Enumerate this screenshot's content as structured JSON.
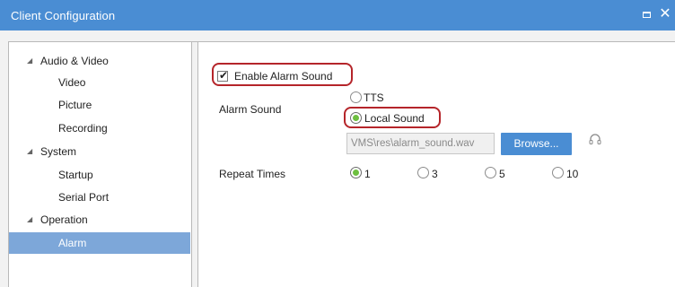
{
  "window": {
    "title": "Client Configuration",
    "maximize_icon": "maximize-icon",
    "close_icon": "close-icon",
    "close_glyph": "✕"
  },
  "tree": {
    "groups": [
      {
        "label": "Audio & Video",
        "caret": "◢",
        "children": [
          "Video",
          "Picture",
          "Recording"
        ]
      },
      {
        "label": "System",
        "caret": "◢",
        "children": [
          "Startup",
          "Serial Port"
        ]
      },
      {
        "label": "Operation",
        "caret": "◢",
        "children": [
          "Alarm"
        ]
      }
    ],
    "selected": "Alarm"
  },
  "alarm": {
    "enable_label": "Enable Alarm Sound",
    "enable_checked": true,
    "check_glyph": "✔",
    "sound_label": "Alarm Sound",
    "sound_options": [
      "TTS",
      "Local Sound"
    ],
    "sound_selected": "Local Sound",
    "file_path": "VMS\\res\\alarm_sound.wav",
    "browse_label": "Browse...",
    "preview_icon": "headphone-icon",
    "repeat_label": "Repeat Times",
    "repeat_options": [
      "1",
      "3",
      "5",
      "10"
    ],
    "repeat_selected": "1"
  },
  "colors": {
    "titlebar": "#4a8dd3",
    "selected_item": "#7da7d9",
    "highlight_border": "#b5252a",
    "radio_on": "#6dbf3f"
  }
}
